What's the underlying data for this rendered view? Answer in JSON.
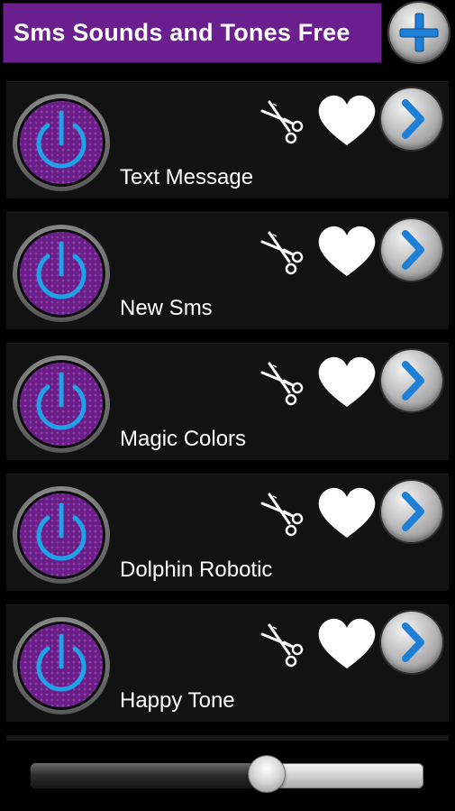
{
  "header": {
    "title": "Sms Sounds and Tones Free",
    "background_color": "#6b1f8f"
  },
  "add_button": {
    "icon": "plus-icon",
    "icon_color": "#1e7fd6"
  },
  "items": [
    {
      "label": "Text Message"
    },
    {
      "label": "New Sms"
    },
    {
      "label": "Magic Colors"
    },
    {
      "label": "Dolphin Robotic"
    },
    {
      "label": "Happy Tone"
    }
  ],
  "item_icons": {
    "play": "power-icon",
    "edit": "scissors-icon",
    "favorite": "heart-icon",
    "open": "chevron-right-icon"
  },
  "colors": {
    "accent_blue": "#1fa3e8",
    "purple": "#7a2a99",
    "row_background": "#111212"
  },
  "volume": {
    "level": 0.6
  }
}
